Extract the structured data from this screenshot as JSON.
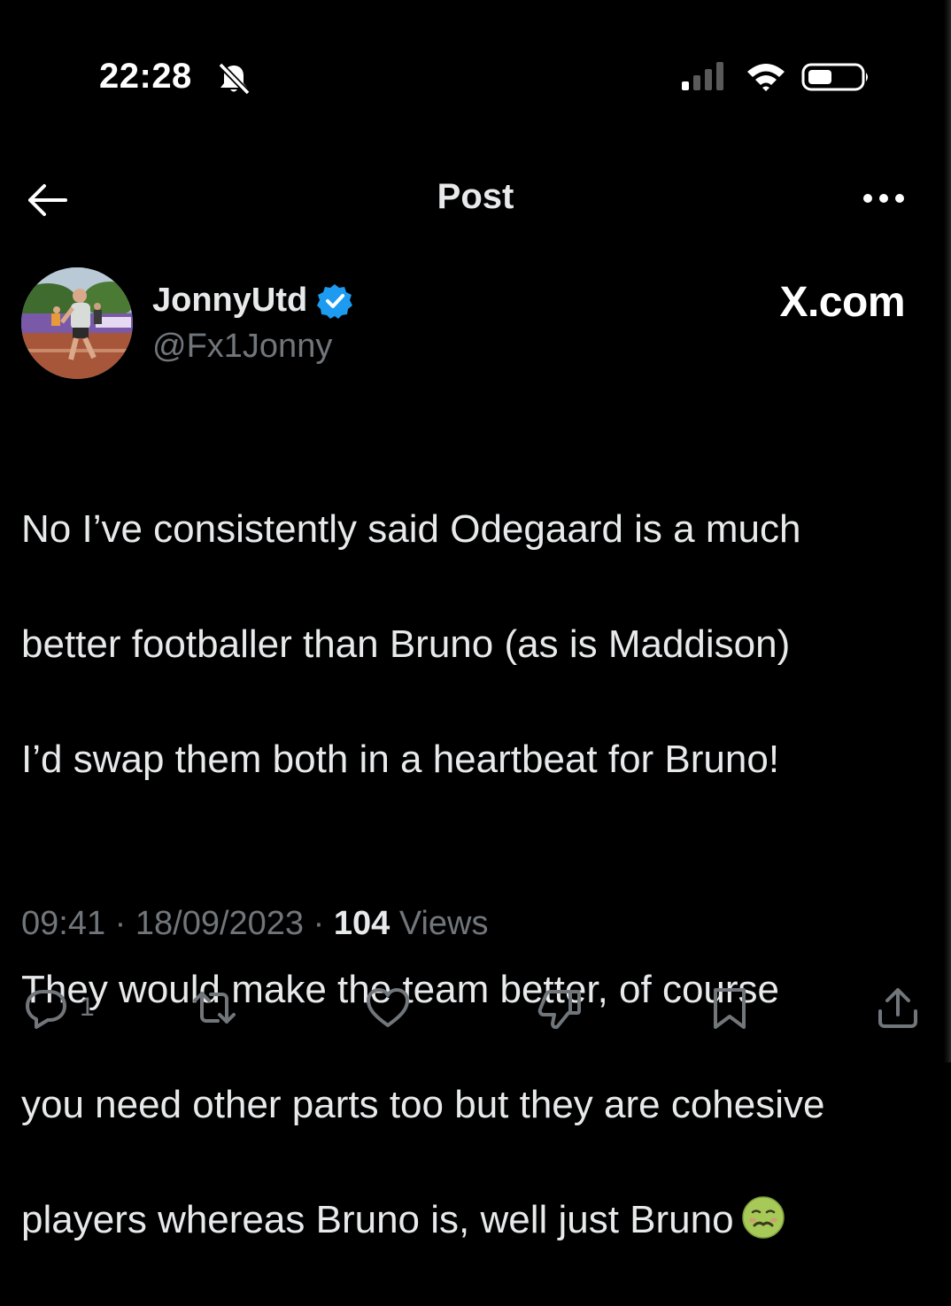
{
  "status_bar": {
    "time": "22:28",
    "icons": [
      "bell-slash-icon",
      "signal-icon",
      "wifi-icon",
      "battery-icon"
    ]
  },
  "header": {
    "title": "Post",
    "back_icon": "back-arrow-icon",
    "more_icon": "more-icon"
  },
  "author": {
    "display_name": "JonnyUtd",
    "handle": "@Fx1Jonny",
    "verified": true,
    "brand": "X.com"
  },
  "post": {
    "lines": [
      "No I’ve consistently said Odegaard is a much",
      "better footballer than Bruno (as is Maddison)",
      "I’d swap them both in a heartbeat for Bruno!",
      "",
      "They would make the team better, of course",
      "you need other parts too but they are cohesive",
      "players whereas Bruno is, well just Bruno"
    ],
    "emoji": "nauseated-face-emoji"
  },
  "meta": {
    "time": "09:41",
    "date": "18/09/2023",
    "views_count": "104",
    "views_label": "Views",
    "separator": "·"
  },
  "actions": {
    "reply_count": "1",
    "icons": [
      "reply-icon",
      "repost-icon",
      "like-icon",
      "dislike-icon",
      "bookmark-icon",
      "share-icon"
    ]
  },
  "colors": {
    "background": "#000000",
    "text": "#e7e9ea",
    "muted": "#71767b",
    "verified": "#1d9bf0"
  }
}
